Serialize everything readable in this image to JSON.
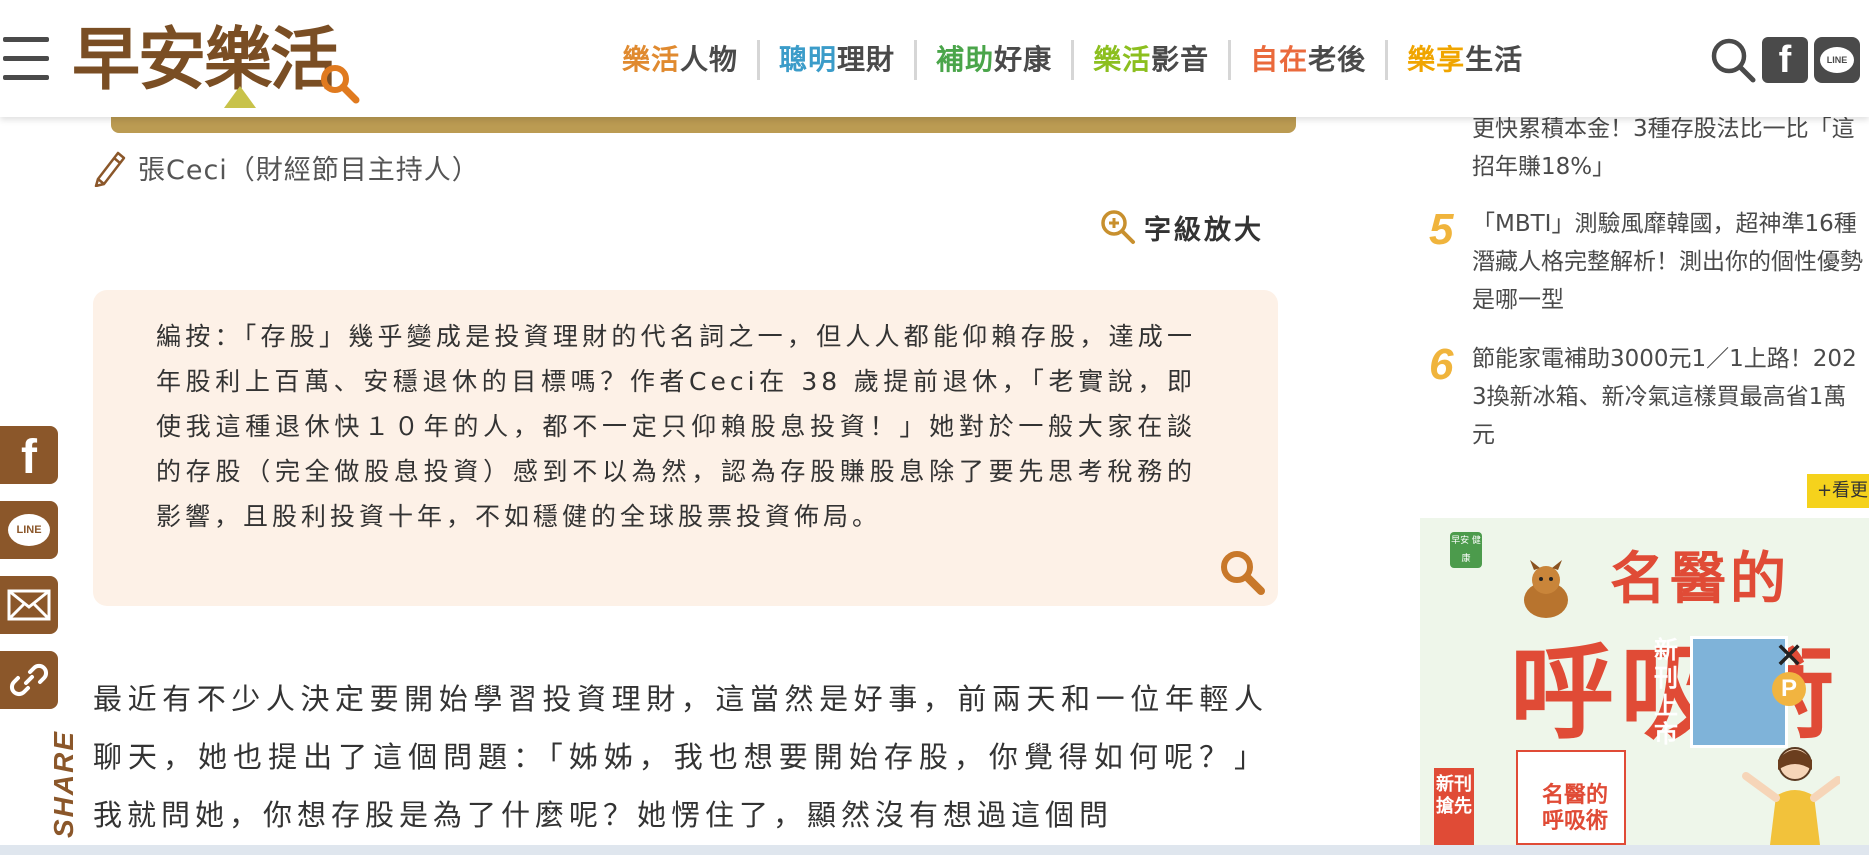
{
  "header": {
    "logo_text": "早安樂活",
    "nav": [
      {
        "accent": "樂活",
        "rest": "人物",
        "color": "#e08a2f"
      },
      {
        "accent": "聰明",
        "rest": "理財",
        "color": "#3b9cc9"
      },
      {
        "accent": "補助",
        "rest": "好康",
        "color": "#4aa54a"
      },
      {
        "accent": "樂活",
        "rest": "影音",
        "color": "#8cbf1f"
      },
      {
        "accent": "自在",
        "rest": "老後",
        "color": "#ea6a3c"
      },
      {
        "accent": "樂享",
        "rest": "生活",
        "color": "#f0a500"
      }
    ],
    "icons": [
      "search-icon",
      "facebook-icon",
      "line-icon"
    ],
    "fb_glyph": "f",
    "line_glyph": "LINE"
  },
  "share": {
    "label": "SHARE",
    "fb_glyph": "f",
    "line_glyph": "LINE",
    "icons": [
      "facebook-icon",
      "line-icon",
      "mail-icon",
      "link-icon"
    ],
    "color": "#8b572a"
  },
  "article": {
    "author": "張Ceci（財經節目主持人）",
    "font_size_label": "字級放大",
    "editor_note": "編按：「存股」幾乎變成是投資理財的代名詞之一，但人人都能仰賴存股，達成一年股利上百萬、安穩退休的目標嗎？作者Ceci在 38 歲提前退休，「老實說，即使我這種退休快１０年的人，都不一定只仰賴股息投資！」她對於一般大家在談的存股（完全做股息投資）感到不以為然，認為存股賺股息除了要先思考稅務的影響，且股利投資十年，不如穩健的全球股票投資佈局。",
    "body": "最近有不少人決定要開始學習投資理財，這當然是好事，前兩天和一位年輕人聊天，她也提出了這個問題：「姊姊，我也想要開始存股，你覺得如何呢？」我就問她，你想存股是為了什麼呢？她愣住了，顯然沒有想過這個問"
  },
  "sidebar": {
    "partial_item_text": "更快累積本金！3種存股法比一比「這招年賺18%」",
    "items": [
      {
        "rank": "5",
        "title": "「MBTI」測驗風靡韓國，超神準16種潛藏人格完整解析！測出你的個性優勢是哪一型"
      },
      {
        "rank": "6",
        "title": "節能家電補助3000元1／1上路！2023換新冰箱、新冷氣這樣買最高省1萬元"
      }
    ],
    "more_label": "+看更多",
    "accent": "#f0b43c"
  },
  "ad": {
    "close_glyph": "✕",
    "logo_text": "早安\n健康",
    "headline_top": "名醫的",
    "headline_main": "呼吸術",
    "side_tag": "新刊上市",
    "bottom_tag": "新刊搶先",
    "mini_title": "名醫的\n呼吸術",
    "x_glyph": "✕",
    "p_glyph": "P"
  }
}
